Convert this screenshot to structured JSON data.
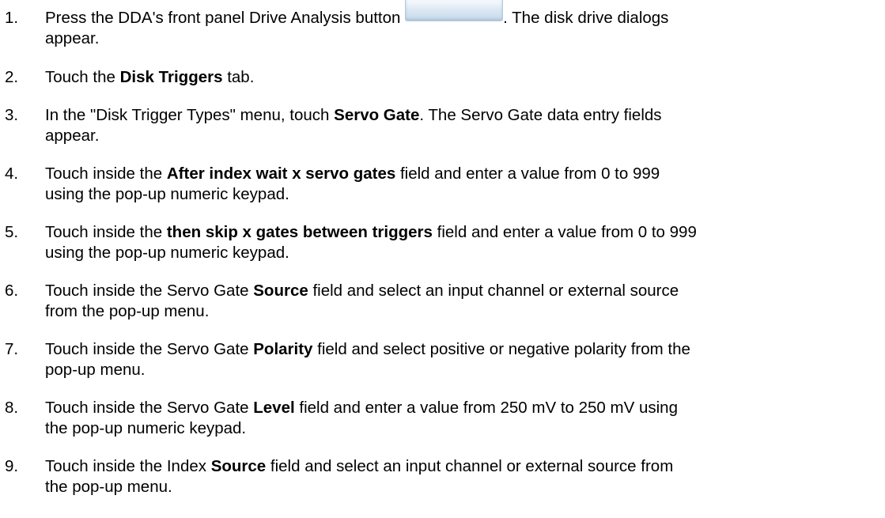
{
  "steps": [
    {
      "number": "1.",
      "line1": {
        "a": "Press the DDA's front panel Drive Analysis button",
        "b": ". The disk drive dialogs"
      },
      "line2": "appear.",
      "button_icon": "drive-analysis-button-icon"
    },
    {
      "number": "2.",
      "line1": {
        "a": "Touch the",
        "bold": "Disk Triggers",
        "b": "tab."
      }
    },
    {
      "number": "3.",
      "line1": {
        "a": "In the \"Disk Trigger Types\" menu, touch",
        "bold": "Servo Gate",
        "b": ". The Servo Gate data entry fields"
      },
      "line2": "appear."
    },
    {
      "number": "4.",
      "line1": {
        "a": "Touch inside the",
        "bold": "After index wait x servo gates",
        "b": "field and enter a value from 0 to 999"
      },
      "line2": "using the pop-up numeric keypad."
    },
    {
      "number": "5.",
      "line1": {
        "a": "Touch inside the",
        "bold": "then skip x gates between triggers",
        "b": "field and enter a value from 0 to 999"
      },
      "line2": "using the pop-up numeric keypad."
    },
    {
      "number": "6.",
      "line1": {
        "a": "Touch inside the Servo Gate",
        "bold": "Source",
        "b": "field and select an input channel or external source"
      },
      "line2": "from the pop-up menu."
    },
    {
      "number": "7.",
      "line1": {
        "a": "Touch inside the Servo Gate",
        "bold": "Polarity",
        "b": "field and select positive or negative polarity from the"
      },
      "line2": "pop-up menu."
    },
    {
      "number": "8.",
      "line1": {
        "a": "Touch inside the Servo Gate",
        "bold": "Level",
        "b": "field and enter a value from 250 mV to 250 mV using"
      },
      "line2": "the pop-up numeric keypad."
    },
    {
      "number": "9.",
      "line1": {
        "a": "Touch inside the Index",
        "bold": "Source",
        "b": "field and select an input channel or external source from"
      },
      "line2": "the pop-up menu."
    }
  ]
}
